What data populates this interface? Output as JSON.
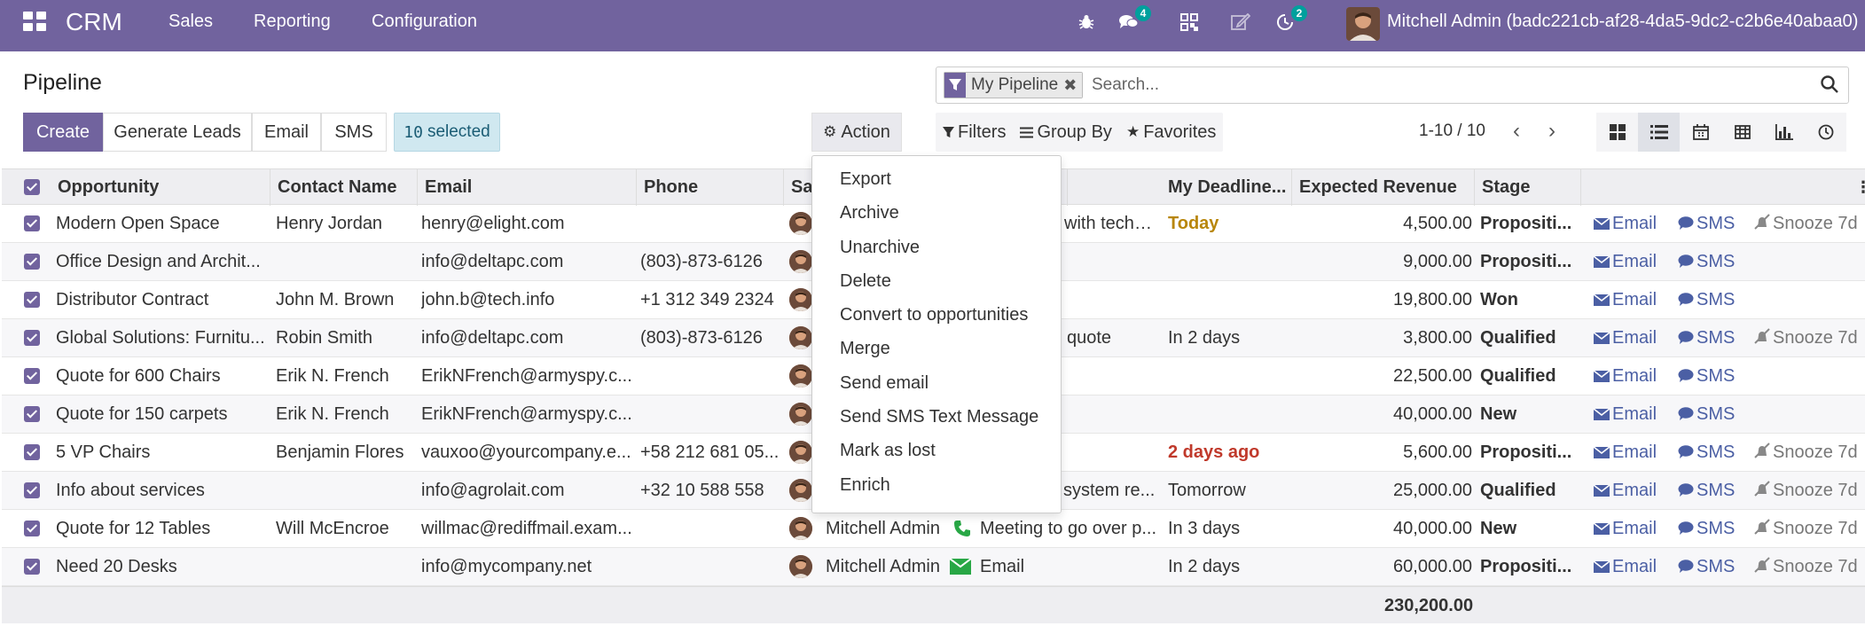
{
  "navbar": {
    "app_name": "CRM",
    "menus": [
      "Sales",
      "Reporting",
      "Configuration"
    ],
    "chat_badge": "4",
    "activity_badge": "2",
    "user": "Mitchell Admin (badc221cb-af28-4da5-9dc2-c2b6e40abaa0)"
  },
  "page": {
    "title": "Pipeline"
  },
  "search": {
    "facet": "My Pipeline",
    "placeholder": "Search..."
  },
  "toolbar": {
    "create": "Create",
    "generate_leads": "Generate Leads",
    "email": "Email",
    "sms": "SMS",
    "selected_count": "10",
    "selected_label": "selected",
    "action": "Action"
  },
  "filters": {
    "filters": "Filters",
    "group_by": "Group By",
    "favorites": "Favorites"
  },
  "pager": {
    "value": "1-10 / 10"
  },
  "columns": {
    "opportunity": "Opportunity",
    "contact": "Contact Name",
    "email": "Email",
    "phone": "Phone",
    "salesperson": "Sa",
    "deadline": "My Deadline...",
    "revenue": "Expected Revenue",
    "stage": "Stage"
  },
  "row_links": {
    "email": "Email",
    "sms": "SMS",
    "snooze": "Snooze 7d"
  },
  "rows": [
    {
      "opportunity": "Modern Open Space",
      "contact": "Henry Jordan",
      "email": "henry@elight.com",
      "phone": "",
      "salesperson": "",
      "activity": "with techni...",
      "deadline": "Today",
      "deadline_style": "today",
      "revenue": "4,500.00",
      "stage": "Propositi...",
      "snooze": true
    },
    {
      "opportunity": "Office Design and Archit...",
      "contact": "",
      "email": "info@deltapc.com",
      "phone": "(803)-873-6126",
      "salesperson": "",
      "activity": "",
      "deadline": "",
      "deadline_style": "",
      "revenue": "9,000.00",
      "stage": "Propositi...",
      "snooze": false
    },
    {
      "opportunity": "Distributor Contract",
      "contact": "John M. Brown",
      "email": "john.b@tech.info",
      "phone": "+1 312 349 2324",
      "salesperson": "",
      "activity": "",
      "deadline": "",
      "deadline_style": "",
      "revenue": "19,800.00",
      "stage": "Won",
      "snooze": false
    },
    {
      "opportunity": "Global Solutions: Furnitu...",
      "contact": "Robin Smith",
      "email": "info@deltapc.com",
      "phone": "(803)-873-6126",
      "salesperson": "",
      "activity": "quote",
      "deadline": "In 2 days",
      "deadline_style": "",
      "revenue": "3,800.00",
      "stage": "Qualified",
      "snooze": true
    },
    {
      "opportunity": "Quote for 600 Chairs",
      "contact": "Erik N. French",
      "email": "ErikNFrench@armyspy.c...",
      "phone": "",
      "salesperson": "",
      "activity": "",
      "deadline": "",
      "deadline_style": "",
      "revenue": "22,500.00",
      "stage": "Qualified",
      "snooze": false
    },
    {
      "opportunity": "Quote for 150 carpets",
      "contact": "Erik N. French",
      "email": "ErikNFrench@armyspy.c...",
      "phone": "",
      "salesperson": "",
      "activity": "",
      "deadline": "",
      "deadline_style": "",
      "revenue": "40,000.00",
      "stage": "New",
      "snooze": false
    },
    {
      "opportunity": "5 VP Chairs",
      "contact": "Benjamin Flores",
      "email": "vauxoo@yourcompany.e...",
      "phone": "+58 212 681 05...",
      "salesperson": "",
      "activity": "",
      "deadline": "2 days ago",
      "deadline_style": "overdue",
      "revenue": "5,600.00",
      "stage": "Propositi...",
      "snooze": true
    },
    {
      "opportunity": "Info about services",
      "contact": "",
      "email": "info@agrolait.com",
      "phone": "+32 10 588 558",
      "salesperson": "",
      "activity": "system re...",
      "deadline": "Tomorrow",
      "deadline_style": "",
      "revenue": "25,000.00",
      "stage": "Qualified",
      "snooze": true
    },
    {
      "opportunity": "Quote for 12 Tables",
      "contact": "Will McEncroe",
      "email": "willmac@rediffmail.exam...",
      "phone": "",
      "salesperson": "Mitchell Admin",
      "activity": "Meeting to go over p...",
      "activity_icon": "phone",
      "deadline": "In 3 days",
      "deadline_style": "",
      "revenue": "40,000.00",
      "stage": "New",
      "snooze": true
    },
    {
      "opportunity": "Need 20 Desks",
      "contact": "",
      "email": "info@mycompany.net",
      "phone": "",
      "salesperson": "Mitchell Admin",
      "activity": "Email",
      "activity_icon": "envelope",
      "deadline": "In 2 days",
      "deadline_style": "",
      "revenue": "60,000.00",
      "stage": "Propositi...",
      "snooze": true
    }
  ],
  "totals": {
    "revenue": "230,200.00"
  },
  "action_menu": [
    "Export",
    "Archive",
    "Unarchive",
    "Delete",
    "Convert to opportunities",
    "Merge",
    "Send email",
    "Send SMS Text Message",
    "Mark as lost",
    "Enrich"
  ]
}
